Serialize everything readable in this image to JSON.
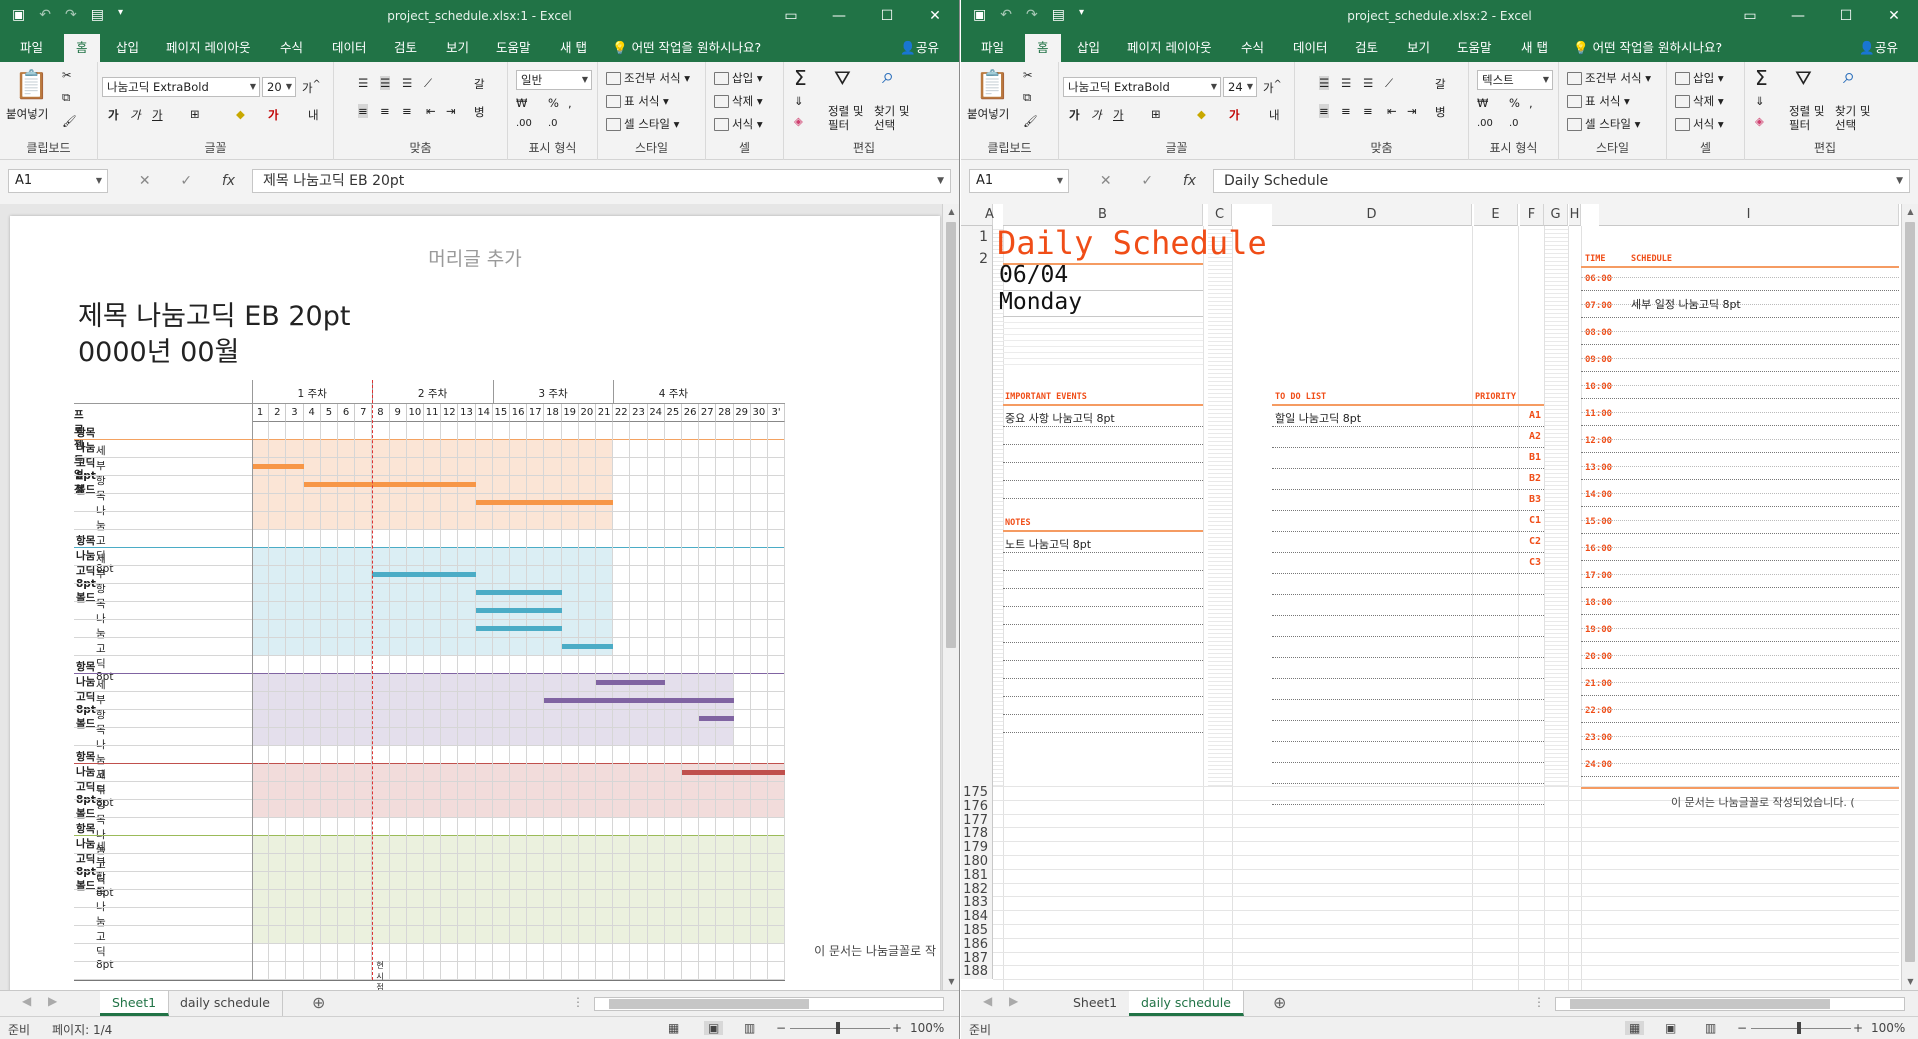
{
  "colors": {
    "accent": "#217346",
    "orange": "#f04d17"
  },
  "ribbon_tabs": [
    "파일",
    "홈",
    "삽입",
    "페이지 레이아웃",
    "수식",
    "데이터",
    "검토",
    "보기",
    "도움말",
    "새 탭"
  ],
  "tell_me": "어떤 작업을 원하시나요?",
  "share": "공유",
  "ribbon": {
    "paste": "붙여넣기",
    "clipboard": "클립보드",
    "font_group": "글꼴",
    "align_group": "맞춤",
    "number_group": "표시 형식",
    "style_group": "스타일",
    "cell_group": "셀",
    "edit_group": "편집",
    "cond_format": "조건부 서식",
    "table_format": "표 서식",
    "cell_style": "셀 스타일",
    "insert": "삽입",
    "delete": "삭제",
    "format": "서식",
    "sort_filter": "정렬 및\n필터",
    "find_select": "찾기 및\n선택",
    "font_name": "나눔고딕 ExtraBold",
    "bold": "가",
    "italic": "가",
    "underline": "가",
    "percent": "%",
    "comma": ",",
    "wrap": "갈",
    "merge": "병"
  },
  "window1": {
    "title": "project_schedule.xlsx:1  -  Excel",
    "font_size": "20",
    "number_format": "일반",
    "name_box": "A1",
    "formula": "제목 나눔고딕 EB 20pt",
    "page": {
      "header_placeholder": "머리글 추가",
      "title": "제목 나눔고딕 EB 20pt",
      "subtitle": "0000년 00월",
      "project_label": "프로젝트 일정",
      "weeks": [
        "1 주차",
        "2 주차",
        "3 주차",
        "4 주차"
      ],
      "days": [
        "1",
        "2",
        "3",
        "4",
        "5",
        "6",
        "7",
        "8",
        "9",
        "10",
        "11",
        "12",
        "13",
        "14",
        "15",
        "16",
        "17",
        "18",
        "19",
        "20",
        "21",
        "22",
        "23",
        "24",
        "25",
        "26",
        "27",
        "28",
        "29",
        "30",
        "3'"
      ],
      "groups": [
        {
          "title": "항목 나눔고딕 8pt 볼드",
          "item": "세부항목 나눔고딕 8pt",
          "color": "#fbe5d6",
          "bar": "#f79646",
          "line": "#f4a261",
          "bars": [
            [
              1,
              3,
              1
            ],
            [
              4,
              13,
              2
            ],
            [
              14,
              21,
              3
            ]
          ]
        },
        {
          "title": "항목 나눔고딕 8pt 볼드",
          "item": "세부항목 나눔고딕 8pt",
          "color": "#dbeef4",
          "bar": "#4bacc6",
          "line": "#4bacc6",
          "bars": [
            [
              8,
              13,
              1
            ],
            [
              14,
              18,
              2
            ],
            [
              14,
              18,
              3
            ],
            [
              14,
              18,
              4
            ],
            [
              19,
              21,
              5
            ]
          ]
        },
        {
          "title": "항목 나눔고딕 8pt 볼드",
          "item": "세부항목 나눔고딕 8pt",
          "color": "#e4dfec",
          "bar": "#8064a2",
          "line": "#8064a2",
          "bars": [
            [
              21,
              24,
              0
            ],
            [
              18,
              28,
              1
            ],
            [
              27,
              28,
              2
            ]
          ]
        },
        {
          "title": "항목 나눔고딕 8pt 볼드",
          "item": "세부항목 나눔고딕 8pt",
          "color": "#f2dcdb",
          "bar": "#c0504d",
          "line": "#c0504d",
          "bars": [
            [
              26,
              31,
              0
            ]
          ]
        },
        {
          "title": "항목 나눔고딕 8pt 볼드",
          "item": "세부항목 나눔고딕 8pt",
          "color": "#ebf1de",
          "bar": "#9bbb59",
          "line": "#9bbb59",
          "bars": []
        }
      ],
      "today_label": "현시점",
      "footnote": "이 문서는 나눔글꼴로 작"
    },
    "sheet_tabs": [
      "Sheet1",
      "daily schedule"
    ],
    "active_tab": 0,
    "status_ready": "준비",
    "status_page": "페이지: 1/4",
    "zoom": "100%"
  },
  "window2": {
    "title": "project_schedule.xlsx:2  -  Excel",
    "font_size": "24",
    "number_format": "텍스트",
    "name_box": "A1",
    "formula": "Daily Schedule",
    "columns": [
      "A",
      "B",
      "C",
      "D",
      "E",
      "F",
      "G",
      "H",
      "I"
    ],
    "rows_top": [
      "1",
      "2"
    ],
    "rows_bottom": [
      "175",
      "176",
      "177",
      "178",
      "179",
      "180",
      "181",
      "182",
      "183",
      "184",
      "185",
      "186",
      "187",
      "188"
    ],
    "sheet": {
      "title": "Daily Schedule",
      "date": "06/04",
      "weekday": "Monday",
      "important_label": "IMPORTANT EVENTS",
      "important_item": "중요 사항 나눔고딕 8pt",
      "notes_label": "NOTES",
      "notes_item": "노트 나눔고딕 8pt",
      "todo_label": "TO DO LIST",
      "todo_item": "할일 나눔고딕 8pt",
      "priority_label": "PRIORITY",
      "priorities": [
        "A1",
        "A2",
        "B1",
        "B2",
        "B3",
        "C1",
        "C2",
        "C3"
      ],
      "time_label": "TIME",
      "schedule_label": "SCHEDULE",
      "times": [
        "06:00",
        "07:00",
        "08:00",
        "09:00",
        "10:00",
        "11:00",
        "12:00",
        "13:00",
        "14:00",
        "15:00",
        "16:00",
        "17:00",
        "18:00",
        "19:00",
        "20:00",
        "21:00",
        "22:00",
        "23:00",
        "24:00"
      ],
      "schedule_item": "세부 일정 나눔고딕 8pt",
      "footnote": "이 문서는 나눔글꼴로 작성되었습니다. (",
      "footnote_cut": "이 문서는 나눔글꼴로 작성되었습니다. ("
    },
    "sheet_tabs": [
      "Sheet1",
      "daily schedule"
    ],
    "active_tab": 1,
    "status_ready": "준비",
    "zoom": "100%"
  }
}
